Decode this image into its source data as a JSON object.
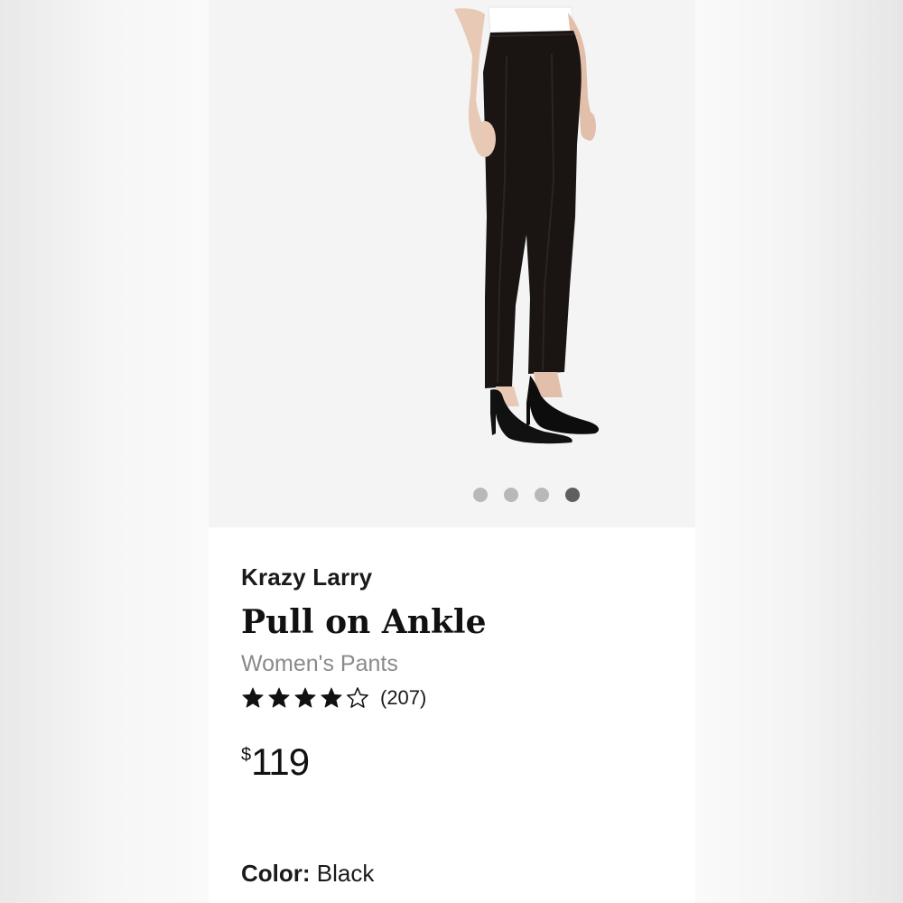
{
  "product": {
    "brand": "Krazy Larry",
    "title": "Pull on Ankle",
    "category": "Women's Pants",
    "rating": {
      "stars_filled": 4,
      "stars_total": 5,
      "review_count": "(207)"
    },
    "price": {
      "currency_symbol": "$",
      "amount": "119"
    },
    "color": {
      "label": "Color:",
      "value": "Black"
    }
  },
  "carousel": {
    "total_images": 4,
    "active_index": 3
  },
  "colors": {
    "dot_inactive": "#b8b8b8",
    "dot_active": "#5f5f5f",
    "star": "#111111",
    "category_text": "#8a8a8a"
  },
  "icons": {
    "star_filled": "star-filled-icon",
    "star_empty": "star-outline-icon"
  }
}
